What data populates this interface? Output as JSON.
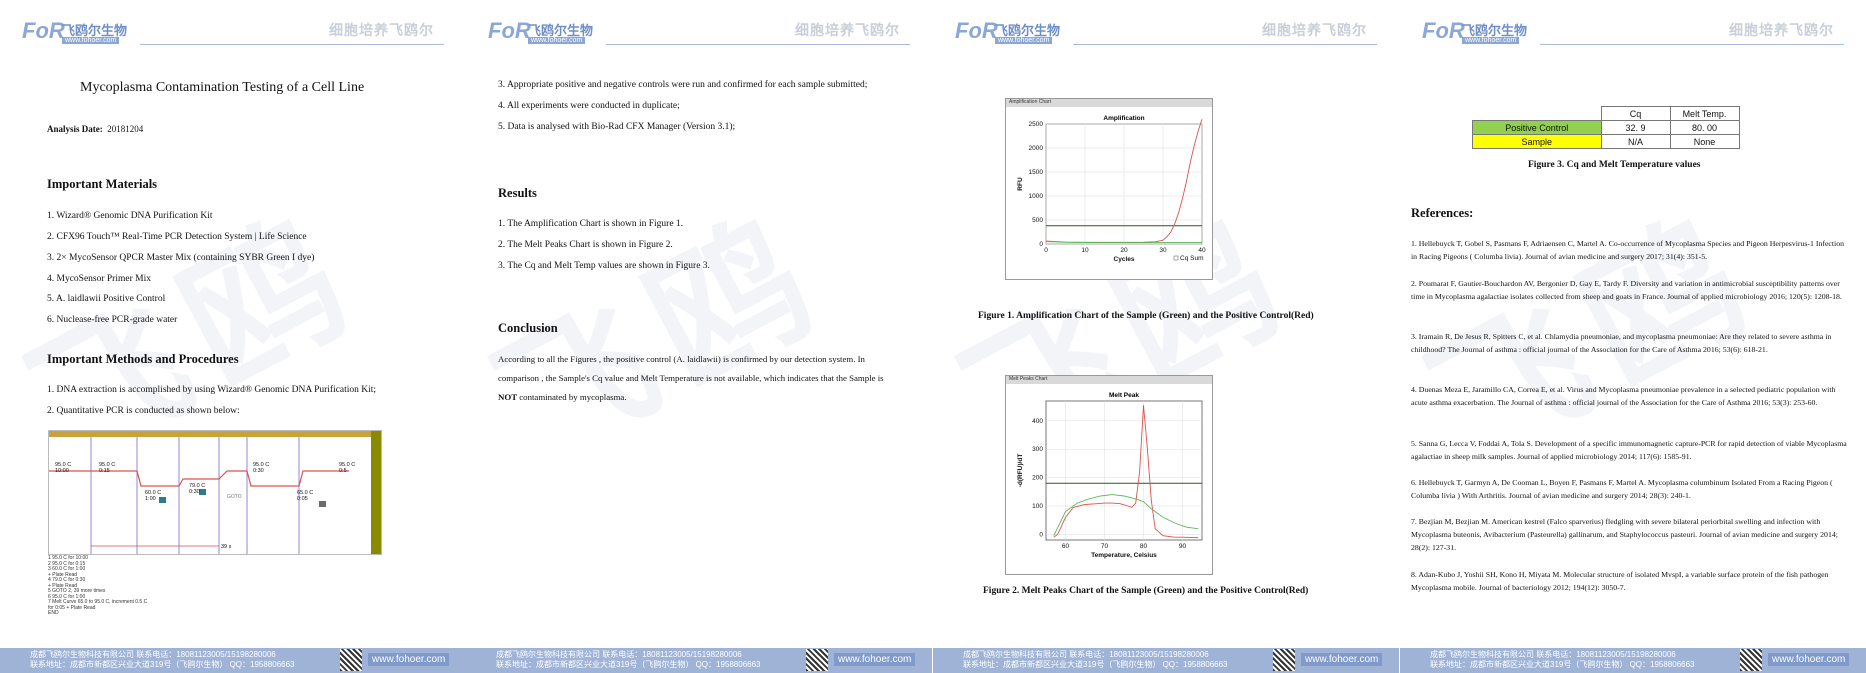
{
  "header": {
    "logo_mark": "FoR",
    "logo_cn": "飞鸥尔生物",
    "logo_url": "www.fohoer.com",
    "slogan": "细胞培养飞鸥尔"
  },
  "footer": {
    "line1": "成都飞鸥尔生物科技有限公司     联系电话：18081123005/15198280006",
    "line2": "联系地址：成都市新都区兴业大道319号（飞鸥尔生物）     QQ：1958806663",
    "url": "www.fohoer.com"
  },
  "watermark": "飞鸥",
  "page1": {
    "title": "Mycoplasma Contamination Testing of a Cell Line",
    "date_label": "Analysis Date:",
    "date_value": "20181204",
    "materials_heading": "Important Materials",
    "materials": [
      "1.   Wizard® Genomic DNA Purification Kit",
      "2.   CFX96 Touch™ Real-Time PCR Detection System | Life Science",
      "3.   2× MycoSensor QPCR Master Mix (containing SYBR Green I dye)",
      "4.   MycoSensor Primer Mix",
      "5.   A. laidlawii Positive Control",
      "6.   Nuclease-free PCR-grade water"
    ],
    "methods_heading": "Important Methods and Procedures",
    "methods": [
      "1.   DNA extraction is accomplished by using Wizard® Genomic DNA Purification Kit;",
      "2.   Quantitative PCR is conducted  as shown below:"
    ],
    "protocol_labels": [
      "95.0 C",
      "10:00",
      "95.0 C",
      "0:15",
      "60.0 C",
      "1:00",
      "79.0 C",
      "0:30",
      "GOTO",
      "95.0 C",
      "0:30",
      "65.0 C",
      "0:05",
      "95.0 C",
      "0:5",
      "39 x"
    ],
    "protocol_steps": [
      "1    95.0 C  for  10:00",
      "2    95.0 C  for  0:15",
      "3    60.0 C  for  1:00",
      "     + Plate Read",
      "4    79.0 C  for  0:30",
      "     + Plate Read",
      "5    GOTO 2, 39  more times",
      "6    95.0 C  for  1:00",
      "7    Melt Curve  65.0  to  95.0 C, increment  0.5 C",
      "     for  0:05    + Plate Read",
      "     END"
    ]
  },
  "page2": {
    "items_top": [
      "3.   Appropriate positive and negative controls were run and confirmed for each sample submitted;",
      "4.   All experiments were conducted in duplicate;",
      "5.   Data is analysed with Bio-Rad CFX Manager (Version 3.1);"
    ],
    "results_heading": "Results",
    "results": [
      "1.    The Amplification Chart is shown in Figure 1.",
      "2.    The Melt Peaks Chart is shown in  Figure 2.",
      "3.    The Cq and Melt Temp values are shown in Figure 3."
    ],
    "conclusion_heading": "Conclusion",
    "conclusion_1": "According to all the Figures , the positive control (A. laidlawii) is confirmed by our detection system. In comparison , the Sample's Cq value and Melt Temperature is not available, which indicates that the Sample is ",
    "conclusion_bold": "NOT",
    "conclusion_2": " contaminated by mycoplasma."
  },
  "page3": {
    "fig1_bar": "Amplification Chart",
    "fig1_caption": "Figure 1.  Amplification Chart of  the Sample (Green) and the Positive Control(Red)",
    "fig2_bar": "Melt Peaks Chart",
    "fig2_caption": "Figure 2.  Melt Peaks Chart of  the Sample (Green) and the Positive Control(Red)"
  },
  "page4": {
    "table": {
      "headers": [
        "",
        "Cq",
        "Melt Temp."
      ],
      "rows": [
        {
          "label": "Positive Control",
          "cq": "32. 9",
          "melt": "80. 00",
          "color": "#92d050"
        },
        {
          "label": "Sample",
          "cq": "N/A",
          "melt": "None",
          "color": "#ffff00"
        }
      ]
    },
    "table_caption": "Figure 3.  Cq and Melt Temperature values",
    "refs_heading": "References:",
    "refs": [
      "1.    Hellebuyck T, Gobel S, Pasmans F, Adriaensen C, Martel A. Co-occurrence of Mycoplasma Species and Pigeon Herpesvirus-1 Infection in Racing Pigeons ( Columba livia). Journal of avian medicine and surgery  2017; 31(4): 351-5.",
      "2.    Poumarat F, Gautier-Bouchardon AV, Bergonier D, Gay E, Tardy F. Diversity and variation in antimicrobial susceptibility patterns over time in Mycoplasma agalactiae isolates collected from sheep and goats in France. Journal of applied microbiology 2016; 120(5): 1208-18.",
      "3.    Iramain R, De Jesus R, Spitters C, et al. Chlamydia pneumoniae, and mycoplasma pneumoniae: Are they related to severe asthma in childhood? The Journal of asthma : official journal of the Association for the Care of Asthma 2016; 53(6): 618-21.",
      "4.    Duenas Meza E, Jaramillo CA, Correa E, et al. Virus and Mycoplasma pneumoniae prevalence in a selected pediatric population with acute asthma exacerbation. The Journal of asthma : official journal of the Association for the Care of Asthma 2016; 53(3): 253-60.",
      "5.    Sanna G, Lecca V, Foddai A, Tola S. Development of a specific immunomagnetic capture-PCR for rapid detection of viable Mycoplasma agalactiae in sheep milk samples. Journal of applied microbiology 2014; 117(6): 1585-91.",
      "6.    Hellebuyck T, Garmyn A, De Cooman L, Boyen F, Pasmans F, Martel A. Mycoplasma columbinum Isolated From a Racing Pigeon ( Columba livia ) With Arthritis. Journal of avian medicine and surgery 2014; 28(3): 240-1.",
      "7.    Bezjian M, Bezjian M. American kestrel (Falco sparverius) fledgling with severe bilateral periorbital swelling and infection with Mycoplasma buteonis, Avibacterium (Pasteurella) gallinarum, and Staphylococcus pasteuri. Journal of avian medicine and surgery 2014; 28(2): 127-31.",
      "8.    Adan-Kubo J, Yoshii SH, Kono H, Miyata M. Molecular structure of isolated MvspI, a variable surface protein of the fish pathogen Mycoplasma mobile. Journal of bacteriology 2012; 194(12): 3050-7."
    ]
  },
  "chart_data": [
    {
      "type": "line",
      "title": "Amplification",
      "xlabel": "Cycles",
      "ylabel": "RFU",
      "xlim": [
        0,
        40
      ],
      "ylim": [
        0,
        2500
      ],
      "xticks": [
        0,
        10,
        20,
        30,
        40
      ],
      "yticks": [
        0,
        500,
        1000,
        1500,
        2000,
        2500
      ],
      "grid": true,
      "legend": "bottom-right",
      "legend_text": "Cq Sum",
      "threshold": 380,
      "series": [
        {
          "color": "#d9534f",
          "x": [
            0,
            5,
            10,
            15,
            20,
            25,
            28,
            30,
            31,
            32,
            33,
            34,
            35,
            36,
            37,
            38,
            39,
            40
          ],
          "y": [
            60,
            40,
            35,
            35,
            35,
            38,
            45,
            80,
            150,
            250,
            420,
            650,
            950,
            1300,
            1700,
            2050,
            2350,
            2600
          ]
        },
        {
          "color": "#5cb85c",
          "x": [
            0,
            5,
            10,
            15,
            20,
            25,
            30,
            35,
            40
          ],
          "y": [
            50,
            35,
            32,
            30,
            30,
            30,
            30,
            30,
            30
          ]
        }
      ]
    },
    {
      "type": "line",
      "title": "Melt Peak",
      "xlabel": "Temperature, Celsius",
      "ylabel": "-d(RFU)/dT",
      "xlim": [
        55,
        95
      ],
      "ylim": [
        -20,
        470
      ],
      "xticks": [
        60,
        70,
        80,
        90
      ],
      "yticks": [
        0,
        100,
        200,
        300,
        400
      ],
      "grid": true,
      "threshold": 180,
      "series": [
        {
          "color": "#d9534f",
          "x": [
            57,
            58,
            60,
            62,
            65,
            68,
            70,
            72,
            74,
            76,
            77,
            78,
            79,
            80,
            81,
            82,
            83,
            85,
            88,
            90,
            94
          ],
          "y": [
            -10,
            0,
            60,
            95,
            105,
            108,
            110,
            110,
            108,
            100,
            95,
            110,
            220,
            455,
            300,
            120,
            20,
            -5,
            -10,
            -10,
            -12
          ]
        },
        {
          "color": "#5cb85c",
          "x": [
            57,
            60,
            63,
            66,
            69,
            72,
            75,
            78,
            80,
            82,
            85,
            88,
            91,
            94
          ],
          "y": [
            -5,
            80,
            110,
            125,
            135,
            140,
            135,
            125,
            115,
            90,
            60,
            40,
            25,
            20
          ]
        }
      ]
    }
  ]
}
